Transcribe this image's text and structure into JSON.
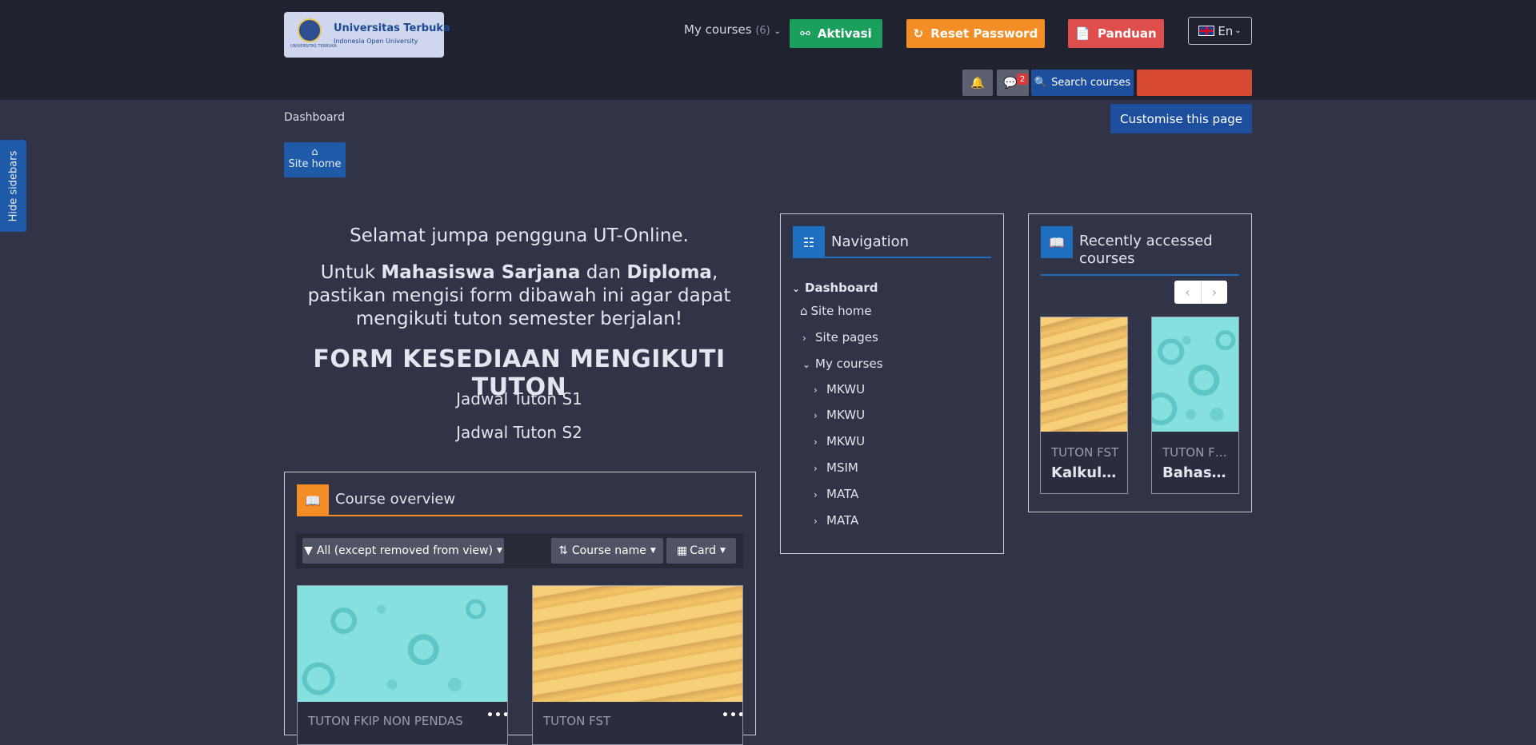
{
  "header": {
    "logo": {
      "title": "Universitas Terbuka",
      "subtitle": "Indonesia Open University",
      "seal_text": "UNIVERSITAS TERBUKA"
    },
    "my_courses": {
      "label": "My courses",
      "count": "(6)"
    },
    "buttons": {
      "aktivasi": "Aktivasi",
      "reset_password": "Reset Password",
      "panduan": "Panduan"
    },
    "language": "En",
    "message_count": "2",
    "search_label": "Search courses",
    "user_menu_label": ""
  },
  "icons": {
    "chevron": "chevron-down-icon",
    "key": "key-icon",
    "refresh": "refresh-icon",
    "file": "file-icon",
    "bell": "bell-icon",
    "comment": "comment-icon",
    "search": "search-icon",
    "home": "home-icon",
    "sitemap": "sitemap-icon",
    "book": "book-icon",
    "filter": "filter-icon",
    "sort": "sort-icon",
    "grid": "grid-icon"
  },
  "breadcrumb": "Dashboard",
  "customise_label": "Customise this page",
  "site_home_label": "Site home",
  "hide_sidebars_label": "Hide sidebars",
  "welcome": {
    "line1": "Selamat jumpa pengguna UT-Online.",
    "line2": {
      "a": "Untuk ",
      "b": "Mahasiswa Sarjana",
      "c": " dan ",
      "d": "Diploma",
      "e": ", pastikan mengisi form dibawah ini agar dapat mengikuti tuton semester berjalan!"
    },
    "form_title": "FORM KESEDIAAN MENGIKUTI TUTON",
    "schedule_s1": "Jadwal Tuton S1",
    "schedule_s2": "Jadwal Tuton S2"
  },
  "course_overview": {
    "title": "Course overview",
    "filter_label": "All (except removed from view)",
    "sort_label": "Course name",
    "view_label": "Card",
    "cards": [
      {
        "category": "TUTON FKIP NON PENDAS",
        "name": ""
      },
      {
        "category": "TUTON FST",
        "name": ""
      }
    ]
  },
  "navigation": {
    "title": "Navigation",
    "dashboard": "Dashboard",
    "site_home": "Site home",
    "site_pages": "Site pages",
    "my_courses": "My courses",
    "courses": [
      "MKWU",
      "MKWU",
      "MKWU",
      "MSIM",
      "MATA",
      "MATA"
    ]
  },
  "recent": {
    "title": "Recently accessed courses",
    "cards": [
      {
        "category": "TUTON FST",
        "name": "Kalkulus ..."
      },
      {
        "category": "TUTON FK...",
        "name": "Bahasa I..."
      }
    ]
  },
  "colors": {
    "background": "#313346",
    "header": "#21222f",
    "aktivasi": "#1aa05c",
    "reset": "#f38d25",
    "panduan": "#dd4e4c",
    "primary": "#1e4f9f"
  }
}
